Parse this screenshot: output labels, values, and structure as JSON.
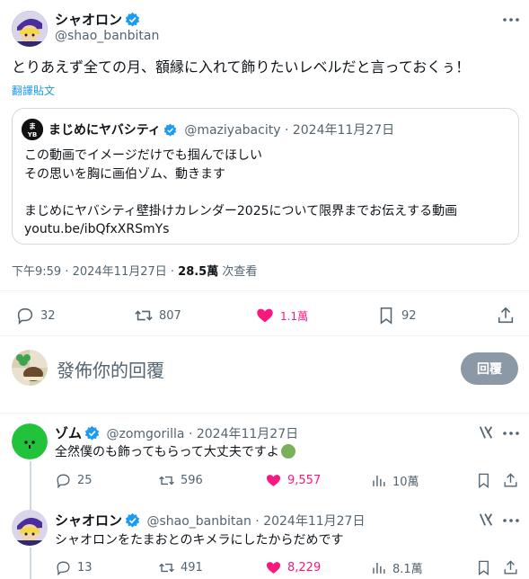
{
  "main_tweet": {
    "author_name": "シャオロン",
    "author_handle": "@shao_banbitan",
    "text": "とりあえず全ての月、額縁に入れて飾りたいレベルだと言っておくぅ！",
    "translate": "翻譯貼文",
    "quote": {
      "author_name": "まじめにヤバシティ",
      "author_handle": "@maziyabacity",
      "sep": "·",
      "date": "2024年11月27日",
      "lines": [
        "この動画でイメージだけでも掴んでほしい",
        "その思いを胸に画伯ゾム、動きます",
        "",
        "まじめにヤバシティ壁掛けカレンダー2025について限界までお伝えする動画",
        "youtu.be/ibQfxXRSmYs"
      ]
    },
    "meta_time": "下午9:59 · 2024年11月27日 · ",
    "meta_views": "28.5萬",
    "meta_views_label": " 次查看",
    "stats": {
      "replies": "32",
      "retweets": "807",
      "likes": "1.1萬",
      "bookmarks": "92"
    }
  },
  "compose": {
    "placeholder": "發佈你的回覆",
    "reply_button": "回覆"
  },
  "replies": [
    {
      "author_name": "ゾム",
      "author_handle": "@zomgorilla",
      "sep": "·",
      "date": "2024年11月27日",
      "text": "全然僕のも飾ってもらって大丈夫ですよ",
      "emoji": "green-circle",
      "stats": {
        "replies": "25",
        "retweets": "596",
        "likes": "9,557",
        "views": "10萬"
      }
    },
    {
      "author_name": "シャオロン",
      "author_handle": "@shao_banbitan",
      "sep": "·",
      "date": "2024年11月27日",
      "text": "シャオロンをたまおとのキメラにしたからだめです",
      "stats": {
        "replies": "13",
        "retweets": "491",
        "likes": "8,229",
        "views": "8.1萬"
      }
    }
  ],
  "colors": {
    "accent": "#1d9bf0",
    "like": "#f91880",
    "gray": "#536471",
    "verified_blue": "#1d9bf0",
    "verified_gold": "#e2b719"
  }
}
